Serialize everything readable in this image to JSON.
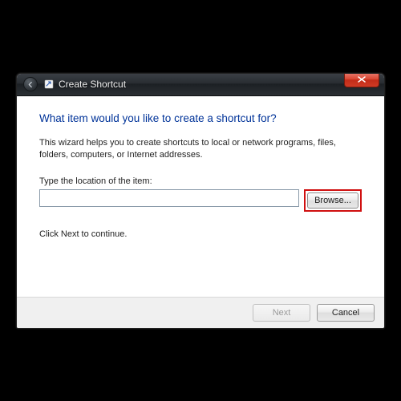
{
  "window": {
    "title": "Create Shortcut"
  },
  "content": {
    "heading": "What item would you like to create a shortcut for?",
    "description": "This wizard helps you to create shortcuts to local or network programs, files, folders, computers, or Internet addresses.",
    "location_label": "Type the location of the item:",
    "location_value": "",
    "browse_label": "Browse...",
    "hint": "Click Next to continue."
  },
  "footer": {
    "next_label": "Next",
    "cancel_label": "Cancel"
  }
}
